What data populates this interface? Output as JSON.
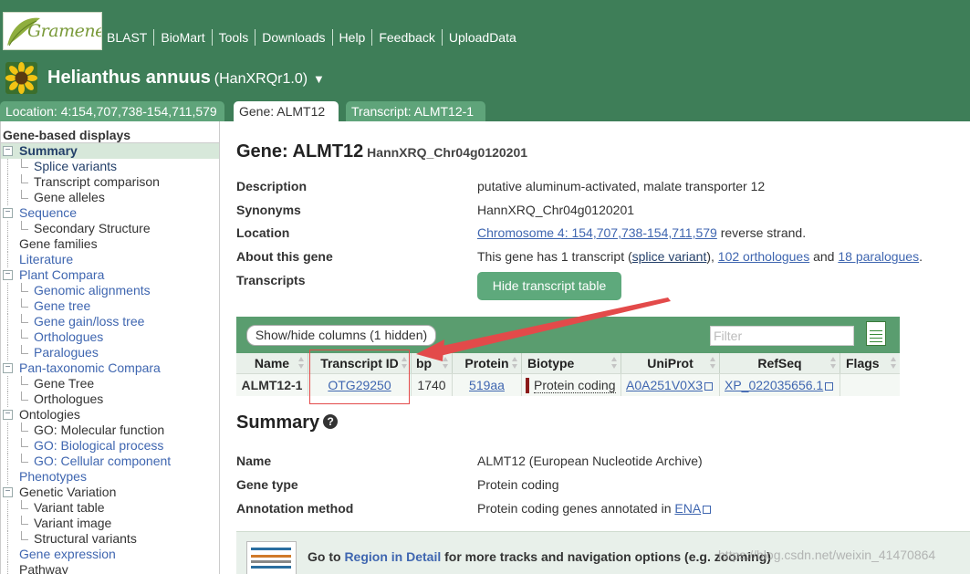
{
  "header": {
    "logo_text": "Gramene",
    "nav": [
      "BLAST",
      "BioMart",
      "Tools",
      "Downloads",
      "Help",
      "Feedback",
      "UploadData"
    ],
    "species_name": "Helianthus annuus",
    "assembly": "(HanXRQr1.0)",
    "species_caret": "▼",
    "tabs": {
      "location": "Location: 4:154,707,738-154,711,579",
      "gene": "Gene: ALMT12",
      "transcript": "Transcript: ALMT12-1"
    }
  },
  "sidebar": {
    "heading": "Gene-based displays",
    "items": [
      {
        "label": "Summary",
        "level": 0,
        "box": "−",
        "active": true,
        "link": false
      },
      {
        "label": "Splice variants",
        "level": 1,
        "link": false,
        "active_child": true
      },
      {
        "label": "Transcript comparison",
        "level": 1,
        "link": false
      },
      {
        "label": "Gene alleles",
        "level": 1,
        "link": false
      },
      {
        "label": "Sequence",
        "level": 0,
        "box": "−",
        "link": true
      },
      {
        "label": "Secondary Structure",
        "level": 1,
        "link": false
      },
      {
        "label": "Gene families",
        "level": 0,
        "link": false
      },
      {
        "label": "Literature",
        "level": 0,
        "link": true
      },
      {
        "label": "Plant Compara",
        "level": 0,
        "box": "−",
        "link": true
      },
      {
        "label": "Genomic alignments",
        "level": 1,
        "link": true
      },
      {
        "label": "Gene tree",
        "level": 1,
        "link": true
      },
      {
        "label": "Gene gain/loss tree",
        "level": 1,
        "link": true
      },
      {
        "label": "Orthologues",
        "level": 1,
        "link": true
      },
      {
        "label": "Paralogues",
        "level": 1,
        "link": true
      },
      {
        "label": "Pan-taxonomic Compara",
        "level": 0,
        "box": "−",
        "link": true
      },
      {
        "label": "Gene Tree",
        "level": 1,
        "link": false
      },
      {
        "label": "Orthologues",
        "level": 1,
        "link": false
      },
      {
        "label": "Ontologies",
        "level": 0,
        "box": "−",
        "link": false
      },
      {
        "label": "GO: Molecular function",
        "level": 1,
        "link": false
      },
      {
        "label": "GO: Biological process",
        "level": 1,
        "link": true
      },
      {
        "label": "GO: Cellular component",
        "level": 1,
        "link": true
      },
      {
        "label": "Phenotypes",
        "level": 0,
        "link": true
      },
      {
        "label": "Genetic Variation",
        "level": 0,
        "box": "−",
        "link": false
      },
      {
        "label": "Variant table",
        "level": 1,
        "link": false
      },
      {
        "label": "Variant image",
        "level": 1,
        "link": false
      },
      {
        "label": "Structural variants",
        "level": 1,
        "link": false
      },
      {
        "label": "Gene expression",
        "level": 0,
        "link": true
      },
      {
        "label": "Pathway",
        "level": 0,
        "link": false
      }
    ]
  },
  "gene": {
    "title": "Gene: ALMT12",
    "stable_id": "HannXRQ_Chr04g0120201",
    "description_label": "Description",
    "description": "putative aluminum-activated, malate transporter 12",
    "synonyms_label": "Synonyms",
    "synonyms": "HannXRQ_Chr04g0120201",
    "location_label": "Location",
    "location_link": "Chromosome 4: 154,707,738-154,711,579",
    "location_suffix": " reverse strand.",
    "about_label": "About this gene",
    "about_prefix": "This gene has 1 transcript (",
    "about_splice": "splice variant",
    "about_mid1": "), ",
    "about_orth": "102 orthologues",
    "about_mid2": " and ",
    "about_para": "18 paralogues",
    "about_end": ".",
    "transcripts_label": "Transcripts",
    "hide_button": "Hide transcript table"
  },
  "transcript_table": {
    "show_hide": "Show/hide columns (1 hidden)",
    "filter_placeholder": "Filter",
    "columns": [
      "Name",
      "Transcript ID",
      "bp",
      "Protein",
      "Biotype",
      "UniProt",
      "RefSeq",
      "Flags"
    ],
    "row": {
      "name": "ALMT12-1",
      "transcript_id": "OTG29250",
      "bp": "1740",
      "protein": "519aa",
      "biotype": "Protein coding",
      "uniprot": "A0A251V0X3",
      "refseq": "XP_022035656.1",
      "flags": ""
    }
  },
  "summary": {
    "title": "Summary",
    "help_icon": "?",
    "name_label": "Name",
    "name_value": "ALMT12 (European Nucleotide Archive)",
    "gene_type_label": "Gene type",
    "gene_type_value": "Protein coding",
    "annotation_label": "Annotation method",
    "annotation_prefix": "Protein coding genes annotated in ",
    "annotation_link": "ENA"
  },
  "region": {
    "prefix": "Go to ",
    "link": "Region in Detail",
    "suffix": " for more tracks and navigation options (e.g. zooming)"
  },
  "watermark": "https://blog.csdn.net/weixin_41470864",
  "colors": {
    "header_green": "#3e7e58",
    "tab_green": "#5fa47a",
    "button_green": "#5ea97c",
    "link_blue": "#3f66b0",
    "annotation_red": "#e34a4a"
  }
}
